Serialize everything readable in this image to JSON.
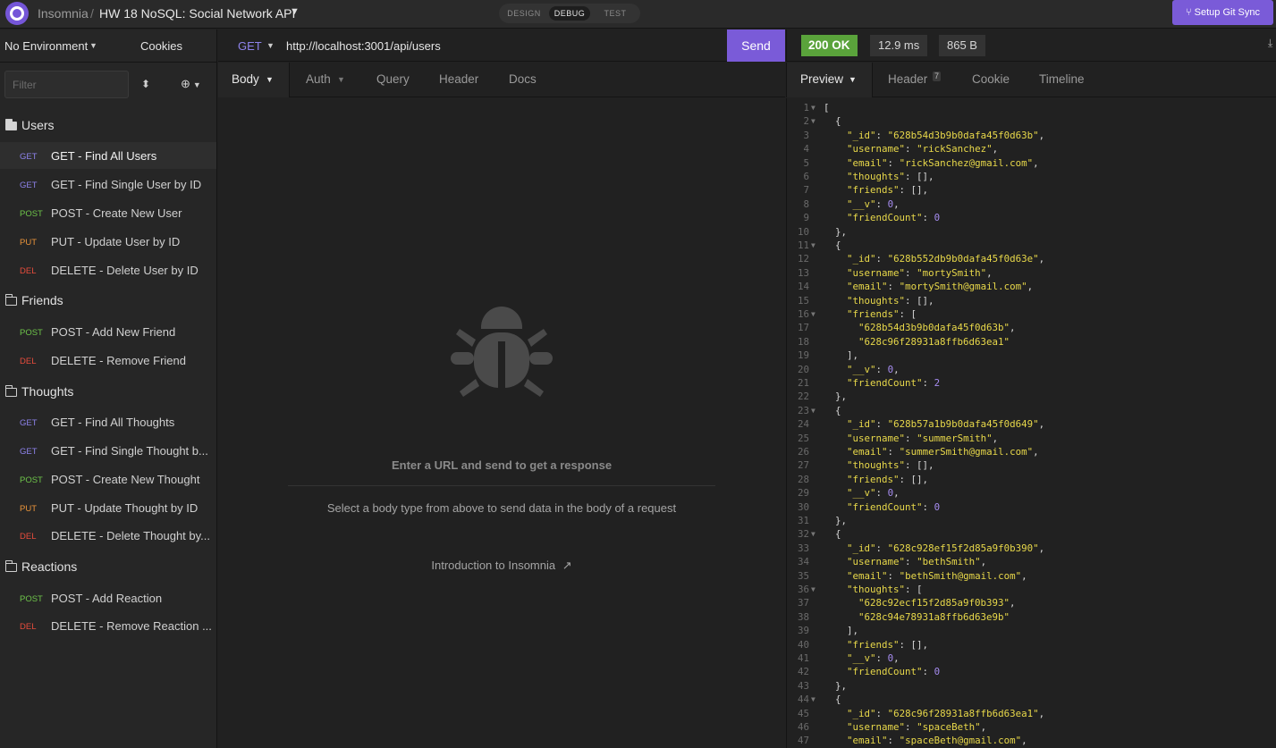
{
  "topbar": {
    "app": "Insomnia",
    "separator": "/",
    "project": "HW 18 NoSQL: Social Network API",
    "modes": {
      "design": "DESIGN",
      "debug": "DEBUG",
      "test": "TEST"
    },
    "git_sync": "Setup Git Sync"
  },
  "sidebar": {
    "environment": "No Environment",
    "cookies": "Cookies",
    "filter_placeholder": "Filter",
    "folders": [
      {
        "name": "Users",
        "requests": [
          {
            "verb": "GET",
            "name": "GET - Find All Users"
          },
          {
            "verb": "GET",
            "name": "GET - Find Single User by ID"
          },
          {
            "verb": "POST",
            "name": "POST - Create New User"
          },
          {
            "verb": "PUT",
            "name": "PUT - Update User by ID"
          },
          {
            "verb": "DEL",
            "name": "DELETE - Delete User by ID"
          }
        ]
      },
      {
        "name": "Friends",
        "requests": [
          {
            "verb": "POST",
            "name": "POST - Add New Friend"
          },
          {
            "verb": "DEL",
            "name": "DELETE - Remove Friend"
          }
        ]
      },
      {
        "name": "Thoughts",
        "requests": [
          {
            "verb": "GET",
            "name": "GET - Find All Thoughts"
          },
          {
            "verb": "GET",
            "name": "GET - Find Single Thought b..."
          },
          {
            "verb": "POST",
            "name": "POST - Create New Thought"
          },
          {
            "verb": "PUT",
            "name": "PUT - Update Thought by ID"
          },
          {
            "verb": "DEL",
            "name": "DELETE - Delete Thought by..."
          }
        ]
      },
      {
        "name": "Reactions",
        "requests": [
          {
            "verb": "POST",
            "name": "POST - Add Reaction"
          },
          {
            "verb": "DEL",
            "name": "DELETE - Remove Reaction ..."
          }
        ]
      }
    ],
    "verb_colors": {
      "GET": "#8e83ec",
      "POST": "#6ec44a",
      "PUT": "#e8933a",
      "DEL": "#e74c3c"
    }
  },
  "request": {
    "method": "GET",
    "url": "http://localhost:3001/api/users",
    "send": "Send",
    "tabs": {
      "body": "Body",
      "auth": "Auth",
      "query": "Query",
      "header": "Header",
      "docs": "Docs"
    },
    "empty_title": "Enter a URL and send to get a response",
    "empty_hint": "Select a body type from above to send data in the body of a request",
    "intro_link": "Introduction to Insomnia"
  },
  "response": {
    "status_code": "200",
    "status_text": "OK",
    "time": "12.9 ms",
    "size": "865 B",
    "tabs": {
      "preview": "Preview",
      "header": "Header",
      "header_count": "7",
      "cookie": "Cookie",
      "timeline": "Timeline"
    },
    "lines": [
      "[",
      "  {",
      "    \"_id\": \"628b54d3b9b0dafa45f0d63b\",",
      "    \"username\": \"rickSanchez\",",
      "    \"email\": \"rickSanchez@gmail.com\",",
      "    \"thoughts\": [],",
      "    \"friends\": [],",
      "    \"__v\": 0,",
      "    \"friendCount\": 0",
      "  },",
      "  {",
      "    \"_id\": \"628b552db9b0dafa45f0d63e\",",
      "    \"username\": \"mortySmith\",",
      "    \"email\": \"mortySmith@gmail.com\",",
      "    \"thoughts\": [],",
      "    \"friends\": [",
      "      \"628b54d3b9b0dafa45f0d63b\",",
      "      \"628c96f28931a8ffb6d63ea1\"",
      "    ],",
      "    \"__v\": 0,",
      "    \"friendCount\": 2",
      "  },",
      "  {",
      "    \"_id\": \"628b57a1b9b0dafa45f0d649\",",
      "    \"username\": \"summerSmith\",",
      "    \"email\": \"summerSmith@gmail.com\",",
      "    \"thoughts\": [],",
      "    \"friends\": [],",
      "    \"__v\": 0,",
      "    \"friendCount\": 0",
      "  },",
      "  {",
      "    \"_id\": \"628c928ef15f2d85a9f0b390\",",
      "    \"username\": \"bethSmith\",",
      "    \"email\": \"bethSmith@gmail.com\",",
      "    \"thoughts\": [",
      "      \"628c92ecf15f2d85a9f0b393\",",
      "      \"628c94e78931a8ffb6d63e9b\"",
      "    ],",
      "    \"friends\": [],",
      "    \"__v\": 0,",
      "    \"friendCount\": 0",
      "  },",
      "  {",
      "    \"_id\": \"628c96f28931a8ffb6d63ea1\",",
      "    \"username\": \"spaceBeth\",",
      "    \"email\": \"spaceBeth@gmail.com\","
    ],
    "foldable_lines": [
      1,
      2,
      11,
      16,
      23,
      32,
      36,
      44
    ]
  }
}
